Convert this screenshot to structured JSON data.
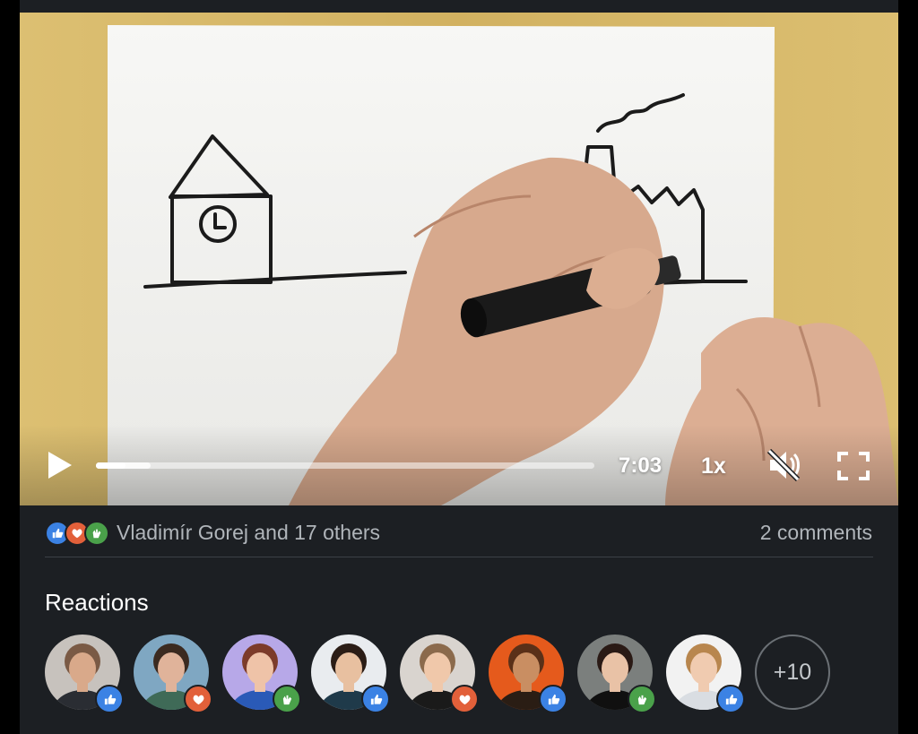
{
  "player": {
    "time": "7:03",
    "speed": "1x",
    "progress_played": 0.06,
    "progress_buffered": 0.11,
    "muted": true
  },
  "reactions_summary": {
    "text": "Vladimír Gorej and 17 others",
    "icons": [
      "like-icon",
      "love-icon",
      "clap-icon"
    ]
  },
  "comments": {
    "label": "2 comments"
  },
  "reactions": {
    "heading": "Reactions",
    "more_label": "+10",
    "people": [
      {
        "badge": "like",
        "bg": "#c7c2bd",
        "skin": "#d9a98a",
        "hair": "#7a5a45",
        "shirt": "#2a2d33"
      },
      {
        "badge": "love",
        "bg": "#7fa7c2",
        "skin": "#e0b39a",
        "hair": "#3b2a20",
        "shirt": "#3f6a57"
      },
      {
        "badge": "clap",
        "bg": "#b7a8e8",
        "skin": "#efc3a8",
        "hair": "#7c3b2a",
        "shirt": "#2a5ab7"
      },
      {
        "badge": "like",
        "bg": "#e9ecef",
        "skin": "#e8c0a0",
        "hair": "#2b1d16",
        "shirt": "#1f3a4a"
      },
      {
        "badge": "love",
        "bg": "#d9d4cf",
        "skin": "#f0c8aa",
        "hair": "#8b6a4c",
        "shirt": "#1a1a1a"
      },
      {
        "badge": "like",
        "bg": "#e55a1c",
        "skin": "#c98e62",
        "hair": "#5a3018",
        "shirt": "#2a1d14"
      },
      {
        "badge": "clap",
        "bg": "#7b7f7d",
        "skin": "#e9c2a6",
        "hair": "#2a1a15",
        "shirt": "#101010"
      },
      {
        "badge": "like",
        "bg": "#f2f2f2",
        "skin": "#f0cbb0",
        "hair": "#b8864e",
        "shirt": "#d9dde2"
      }
    ]
  },
  "colors": {
    "like": "#3b82e4",
    "love": "#e2603a",
    "clap": "#4aa14a"
  }
}
